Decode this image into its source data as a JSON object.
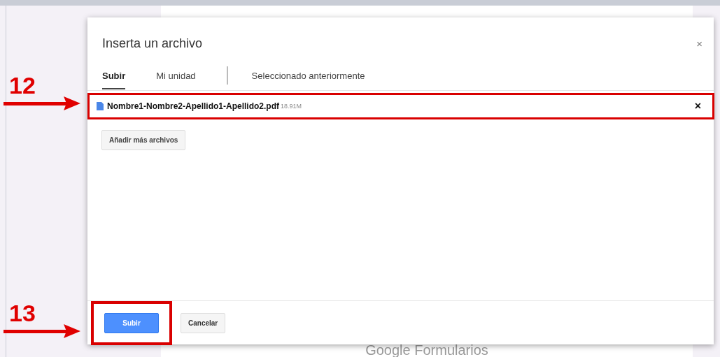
{
  "page": {
    "footer_text": "Google Formularios"
  },
  "dialog": {
    "title": "Inserta un archivo",
    "close": "×",
    "tabs": [
      {
        "label": "Subir",
        "selected": true
      },
      {
        "label": "Mi unidad",
        "selected": false
      },
      {
        "label": "Seleccionado anteriormente",
        "selected": false
      }
    ],
    "file": {
      "name": "Nombre1-Nombre2-Apellido1-Apellido2.pdf",
      "size": "18.91M",
      "remove": "×",
      "highlighted": true
    },
    "add_more": "Añadir más archivos",
    "buttons": [
      {
        "label": "Subir",
        "kind": "primary",
        "highlighted": true
      },
      {
        "label": "Cancelar",
        "kind": "secondary",
        "highlighted": false
      }
    ]
  },
  "annotations": [
    {
      "label": "12"
    },
    {
      "label": "13"
    }
  ]
}
